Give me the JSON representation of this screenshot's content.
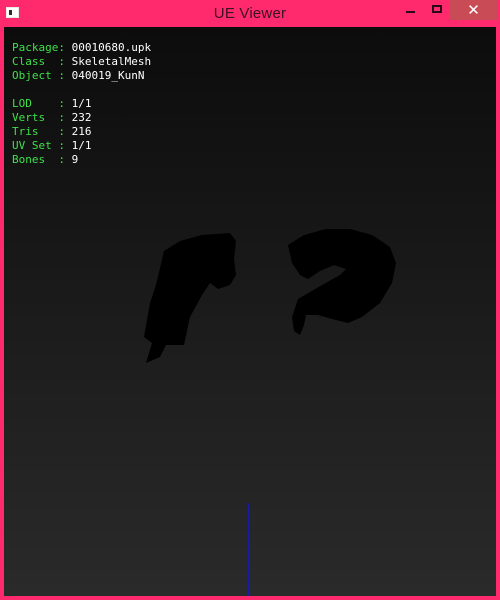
{
  "window": {
    "title": "UE Viewer",
    "icon": "app-icon",
    "buttons": {
      "minimize": "minimize-icon",
      "maximize": "maximize-icon",
      "close": "close-icon",
      "close_glyph": "✕"
    },
    "colors": {
      "frame": "#ff2a6d",
      "close_button": "#c84b55"
    }
  },
  "info": {
    "package_label": "Package:",
    "package_value": "00010680.upk",
    "class_label": "Class  :",
    "class_value": "SkeletalMesh",
    "object_label": "Object :",
    "object_value": "040019_KunN",
    "lod_label": "LOD    :",
    "lod_value": "1/1",
    "verts_label": "Verts  :",
    "verts_value": "232",
    "tris_label": "Tris   :",
    "tris_value": "216",
    "uvset_label": "UV Set :",
    "uvset_value": "1/1",
    "bones_label": "Bones  :",
    "bones_value": "9",
    "colors": {
      "label": "#3fe04a",
      "value": "#ffffff"
    }
  }
}
